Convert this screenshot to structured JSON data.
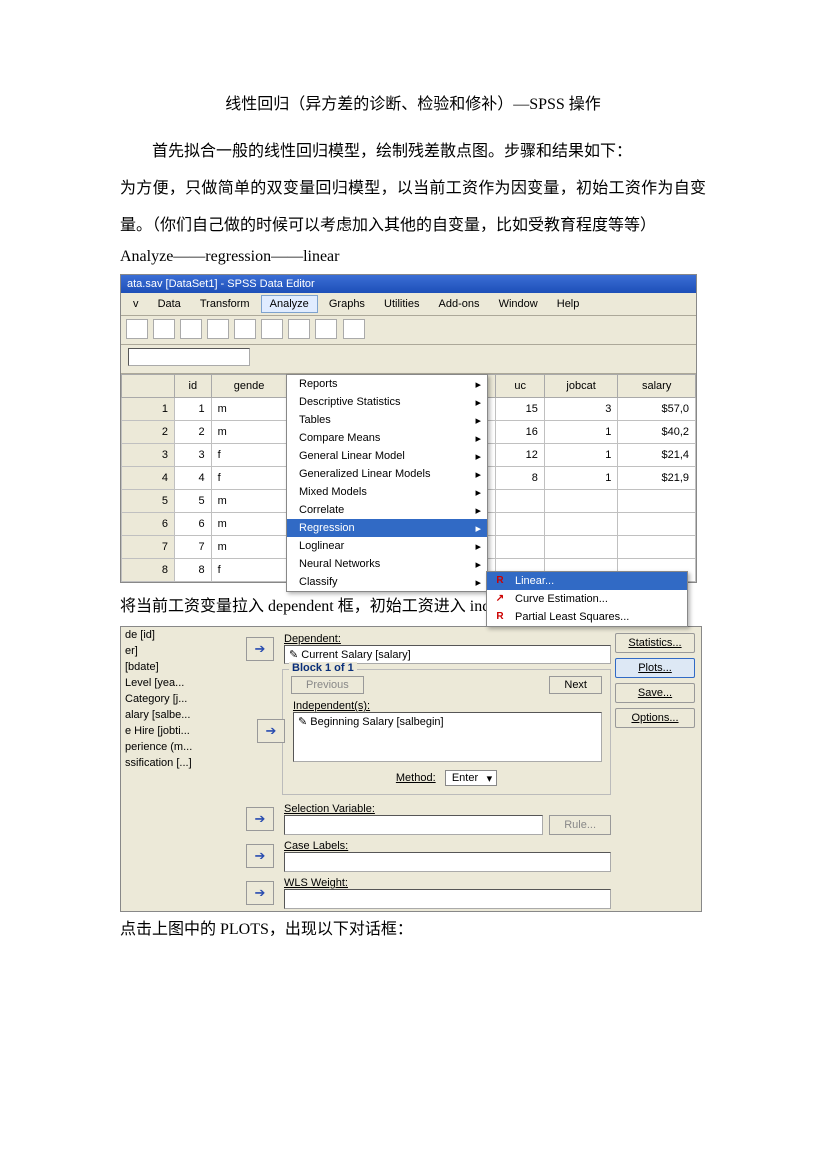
{
  "title": "线性回归（异方差的诊断、检验和修补）—SPSS 操作",
  "p1": "首先拟合一般的线性回归模型，绘制残差散点图。步骤和结果如下：",
  "p2": "为方便，只做简单的双变量回归模型，以当前工资作为因变量，初始工资作为自变量。（你们自己做的时候可以考虑加入其他的自变量，比如受教育程度等等）",
  "pathline": "Analyze――regression――linear",
  "p3": "将当前工资变量拉入 dependent 框，初始工资进入 independent",
  "p4": "点击上图中的 PLOTS，出现以下对话框：",
  "shot1": {
    "titlebar": "ata.sav [DataSet1] - SPSS Data Editor",
    "menu": [
      "v",
      "Data",
      "Transform",
      "Analyze",
      "Graphs",
      "Utilities",
      "Add-ons",
      "Window",
      "Help"
    ],
    "menu_open": "Analyze",
    "headers": [
      "",
      "id",
      "gende",
      "",
      "uc",
      "jobcat",
      "salary"
    ],
    "rows": [
      [
        "1",
        "1",
        "m",
        "",
        "15",
        "3",
        "$57,0"
      ],
      [
        "2",
        "2",
        "m",
        "",
        "16",
        "1",
        "$40,2"
      ],
      [
        "3",
        "3",
        "f",
        "",
        "12",
        "1",
        "$21,4"
      ],
      [
        "4",
        "4",
        "f",
        "",
        "8",
        "1",
        "$21,9"
      ],
      [
        "5",
        "5",
        "m",
        "",
        "",
        "",
        ""
      ],
      [
        "6",
        "6",
        "m",
        "",
        "",
        "",
        ""
      ],
      [
        "7",
        "7",
        "m",
        "",
        "",
        "",
        ""
      ],
      [
        "8",
        "8",
        "f",
        "",
        "",
        "",
        ""
      ]
    ],
    "analyze_menu": [
      "Reports",
      "Descriptive Statistics",
      "Tables",
      "Compare Means",
      "General Linear Model",
      "Generalized Linear Models",
      "Mixed Models",
      "Correlate",
      "Regression",
      "Loglinear",
      "Neural Networks",
      "Classify"
    ],
    "analyze_selected": "Regression",
    "submenu": [
      {
        "icon": "R",
        "label": "Linear...",
        "sel": true
      },
      {
        "icon": "↗",
        "label": "Curve Estimation..."
      },
      {
        "icon": "R",
        "label": "Partial Least Squares..."
      }
    ]
  },
  "shot2": {
    "vars": [
      "de [id]",
      "er]",
      "[bdate]",
      "Level [yea...",
      "Category [j...",
      "alary [salbe...",
      "e Hire [jobti...",
      "perience (m...",
      "ssification [...]"
    ],
    "dependent_label": "Dependent:",
    "dependent_value": "Current Salary [salary]",
    "block_title": "Block 1 of 1",
    "prev": "Previous",
    "next": "Next",
    "independent_label": "Independent(s):",
    "independent_value": "Beginning Salary [salbegin]",
    "method_label": "Method:",
    "method_value": "Enter",
    "selvar": "Selection Variable:",
    "rule": "Rule...",
    "caselab": "Case Labels:",
    "wls": "WLS Weight:",
    "rbtn": [
      "Statistics...",
      "Plots...",
      "Save...",
      "Options..."
    ],
    "rbtn_hi": "Plots..."
  }
}
